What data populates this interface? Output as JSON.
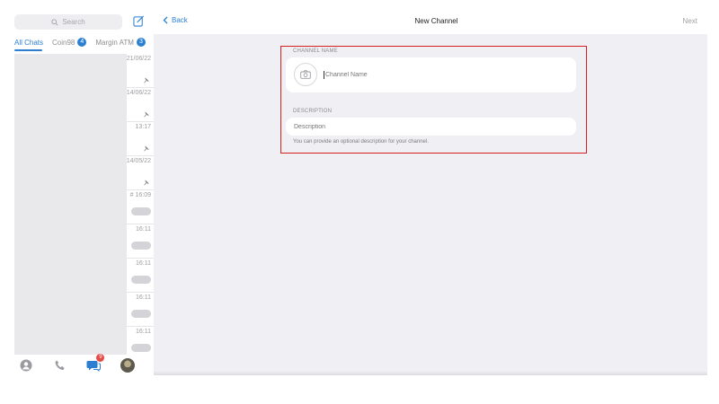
{
  "sidebar": {
    "search_placeholder": "Search",
    "filters": [
      {
        "label": "All Chats",
        "badge": ""
      },
      {
        "label": "Coin98",
        "badge": "4"
      },
      {
        "label": "Margin ATM",
        "badge": "3"
      }
    ],
    "rows": [
      {
        "time": "21/06/22",
        "indicator": "pin"
      },
      {
        "time": "14/06/22",
        "indicator": "pin"
      },
      {
        "time": "13:17",
        "indicator": "pin"
      },
      {
        "time": "14/05/22",
        "indicator": "pin"
      },
      {
        "time": "# 16:09",
        "indicator": "pill"
      },
      {
        "time": "16:11",
        "indicator": "pill"
      },
      {
        "time": "16:11",
        "indicator": "pill"
      },
      {
        "time": "16:11",
        "indicator": "pill"
      },
      {
        "time": "16:11",
        "indicator": "pill"
      }
    ],
    "tabbar": {
      "chats_badge": "9"
    }
  },
  "header": {
    "back_label": "Back",
    "title": "New Channel",
    "next_label": "Next"
  },
  "form": {
    "channel_name_label": "CHANNEL NAME",
    "channel_name_placeholder": "Channel Name",
    "description_label": "DESCRIPTION",
    "description_placeholder": "Description",
    "description_hint": "You can provide an optional description for your channel."
  },
  "colors": {
    "accent": "#2c7fd0",
    "highlight_border": "#d32020",
    "notification_badge": "#e64a45",
    "content_background": "#efeff4"
  }
}
